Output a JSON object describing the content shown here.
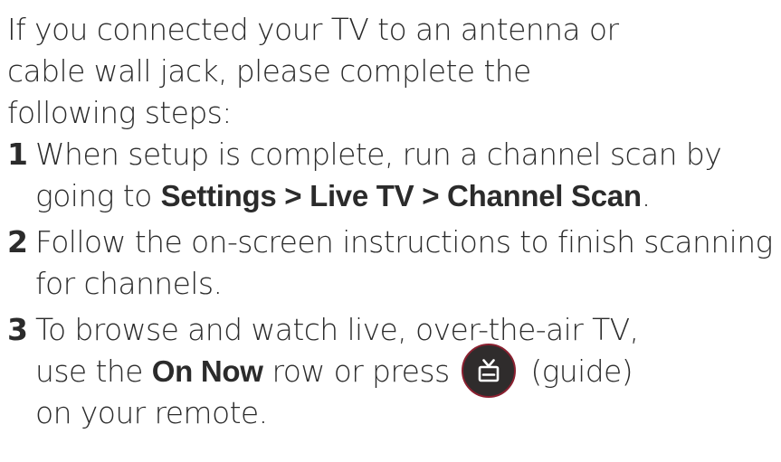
{
  "intro": {
    "line1": "If you connected your TV to an antenna or",
    "line2": "cable wall jack, please complete the",
    "line3": "following steps:"
  },
  "steps": [
    {
      "number": "1",
      "text_before": "When setup is complete, run a channel scan by going to ",
      "path": "Settings > Live TV > Channel Scan",
      "text_after": "."
    },
    {
      "number": "2",
      "text": "Follow the on-screen instructions to finish scanning for channels."
    },
    {
      "number": "3",
      "line1": "To browse and watch live, over-the-air TV,",
      "text_before": "use the ",
      "row_name": "On Now",
      "text_mid": " row or press ",
      "text_after": " (guide)",
      "line3": "on your remote."
    }
  ],
  "icons": {
    "guide_button": "tv-guide-icon"
  },
  "colors": {
    "text": "#2b2b2b",
    "button_fill": "#2f2c2c",
    "button_ring": "#8a2030",
    "icon": "#ffffff"
  }
}
